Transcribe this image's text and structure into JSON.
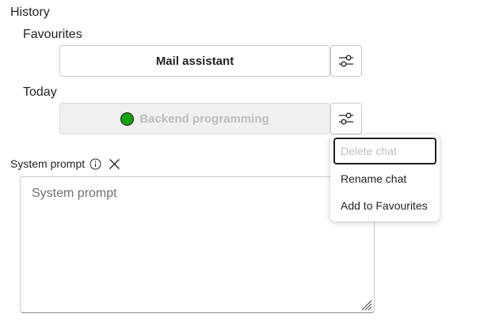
{
  "history": {
    "title": "History",
    "favourites": {
      "title": "Favourites",
      "chats": [
        {
          "label": "Mail assistant",
          "settings_icon": "sliders-icon"
        }
      ]
    },
    "today": {
      "title": "Today",
      "chats": [
        {
          "label": "Backend programming",
          "status_color": "#13a10e",
          "disabled": true,
          "settings_icon": "sliders-icon"
        }
      ]
    }
  },
  "context_menu": {
    "items": [
      {
        "label": "Delete chat",
        "disabled": true
      },
      {
        "label": "Rename chat",
        "disabled": false
      },
      {
        "label": "Add to Favourites",
        "disabled": false
      }
    ]
  },
  "system_prompt": {
    "label": "System prompt",
    "info_icon": "info-icon",
    "clear_icon": "close-icon",
    "placeholder": "System prompt",
    "value": ""
  },
  "colors": {
    "text": "#242424",
    "disabled_text": "#bdbdbd",
    "border": "#c8c8c8",
    "status_green": "#13a10e"
  }
}
